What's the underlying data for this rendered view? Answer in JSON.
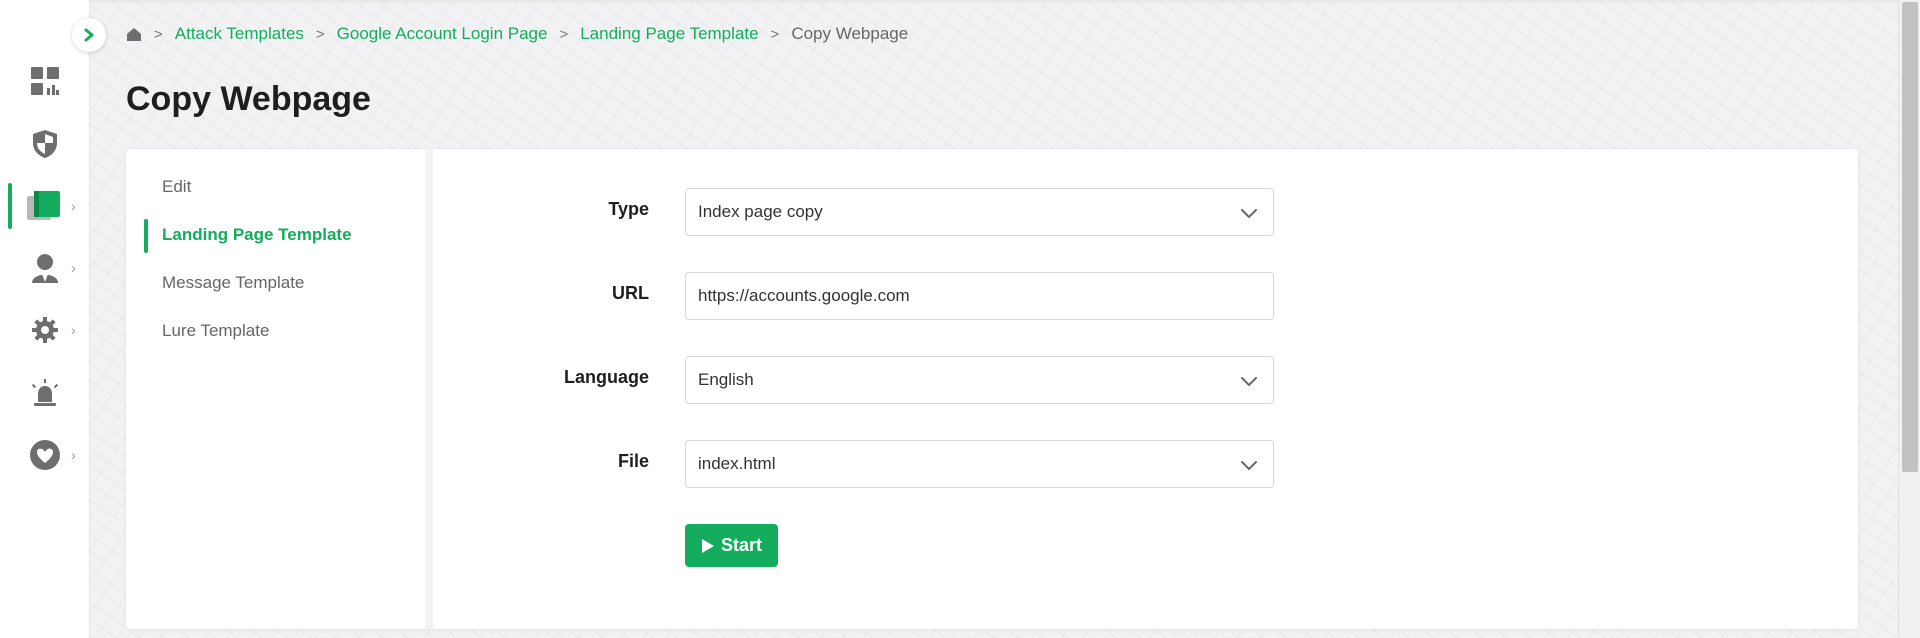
{
  "breadcrumb": {
    "items": [
      "Attack Templates",
      "Google Account Login Page",
      "Landing Page Template"
    ],
    "current": "Copy Webpage",
    "separator": ">"
  },
  "page": {
    "title": "Copy Webpage"
  },
  "sidebar": {
    "icons": [
      "dashboard-icon",
      "shield-icon",
      "templates-icon",
      "users-icon",
      "settings-icon",
      "alarm-icon",
      "heart-chat-icon"
    ]
  },
  "subnav": {
    "items": [
      "Edit",
      "Landing Page Template",
      "Message Template",
      "Lure Template"
    ],
    "active": "Landing Page Template"
  },
  "form": {
    "type": {
      "label": "Type",
      "value": "Index page copy"
    },
    "url": {
      "label": "URL",
      "value": "https://accounts.google.com"
    },
    "language": {
      "label": "Language",
      "value": "English"
    },
    "file": {
      "label": "File",
      "value": "index.html"
    },
    "start_label": "Start"
  },
  "colors": {
    "accent": "#13ad5d",
    "icon": "#6e6e6e"
  }
}
